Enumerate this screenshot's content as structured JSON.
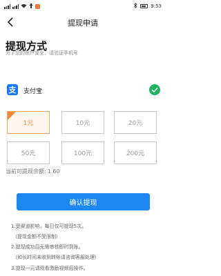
{
  "status_bar": {
    "time": "9:53"
  },
  "nav": {
    "title": "提现申请"
  },
  "page": {
    "heading": "提现方式",
    "subtitle": "为了您的账户安全，请验证手机号"
  },
  "payment": {
    "logo_char": "支",
    "name": "支付宝",
    "selected": true
  },
  "amounts": [
    "1元",
    "10元",
    "20元",
    "50元",
    "100元",
    "200元"
  ],
  "selected_amount": "1元",
  "balance": {
    "label": "当前可提现余额:",
    "value": "1.60"
  },
  "confirm_button": "确认提现",
  "notes": [
    "1.受渠道影响，每日仅可提现5次。",
    "（提现金额不受限制）",
    "2.提现成功后无需审核即时到账。",
    "（如长时间未收到转账请咨询客服处理）",
    "3.提现一元请观看激励视频后操作。"
  ],
  "colors": {
    "accent": "#1e88f0",
    "selected": "#f08a3a",
    "check": "#1fb35a",
    "alipay": "#1677ff"
  }
}
